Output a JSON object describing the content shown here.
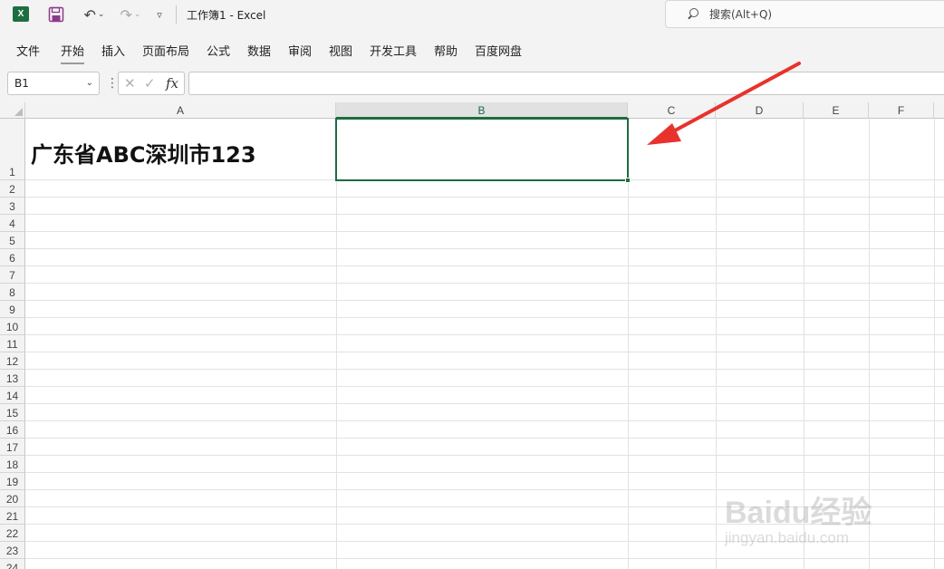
{
  "titlebar": {
    "app_icon_letter": "X",
    "document_title": "工作簿1  -  Excel",
    "search_placeholder": "搜索(Alt+Q)"
  },
  "ribbon": {
    "tabs": [
      {
        "label": "文件"
      },
      {
        "label": "开始",
        "active": true
      },
      {
        "label": "插入"
      },
      {
        "label": "页面布局"
      },
      {
        "label": "公式"
      },
      {
        "label": "数据"
      },
      {
        "label": "审阅"
      },
      {
        "label": "视图"
      },
      {
        "label": "开发工具"
      },
      {
        "label": "帮助"
      },
      {
        "label": "百度网盘"
      }
    ]
  },
  "formula_bar": {
    "name_box": "B1",
    "function_label": "fx",
    "formula_value": ""
  },
  "sheet": {
    "columns": [
      "A",
      "B",
      "C",
      "D",
      "E",
      "F"
    ],
    "selected_column": "B",
    "rows": [
      "1",
      "2",
      "3",
      "4",
      "5",
      "6",
      "7",
      "8",
      "9",
      "10",
      "11",
      "12",
      "13",
      "14",
      "15",
      "16",
      "17",
      "18",
      "19",
      "20",
      "21",
      "22",
      "23",
      "24"
    ],
    "cell_a1": "广东省ABC深圳市123",
    "selected_cell": "B1"
  },
  "colors": {
    "excel_green": "#1e6c41",
    "annotation_arrow": "#e8322c"
  },
  "watermark": {
    "logo": "Baidu经验",
    "url": "jingyan.baidu.com"
  }
}
